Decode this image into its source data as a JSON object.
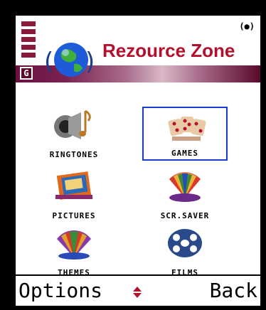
{
  "header": {
    "title": "Rezource Zone",
    "status_letter": "G",
    "battery_indicator": "(●)"
  },
  "grid": {
    "items": [
      {
        "label": "RINGTONES",
        "icon": "ringtones-icon"
      },
      {
        "label": "GAMES",
        "icon": "games-icon",
        "selected": true
      },
      {
        "label": "PICTURES",
        "icon": "pictures-icon"
      },
      {
        "label": "SCR.SAVER",
        "icon": "screensaver-icon"
      },
      {
        "label": "THEMES",
        "icon": "themes-icon"
      },
      {
        "label": "FILMS",
        "icon": "films-icon"
      }
    ]
  },
  "softkeys": {
    "left": "Options",
    "right": "Back"
  },
  "colors": {
    "brand_red": "#b4102e",
    "selection_blue": "#1a3dd6"
  }
}
